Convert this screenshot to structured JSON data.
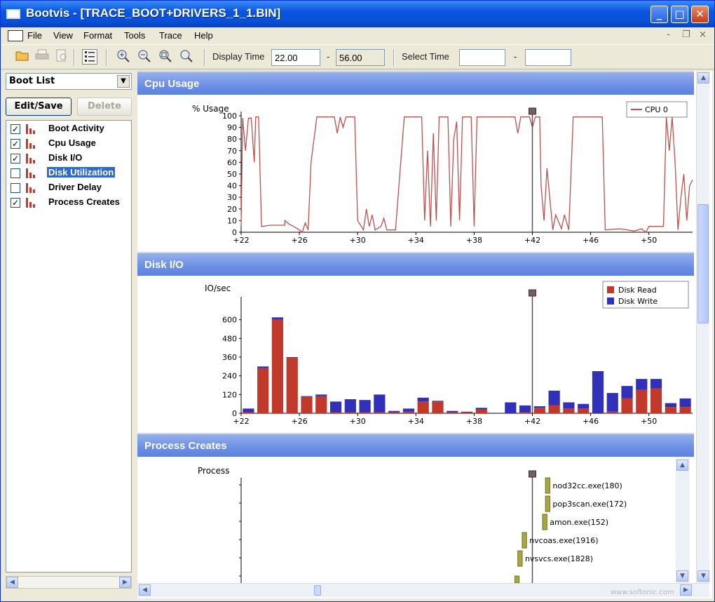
{
  "window": {
    "title": "Bootvis - [TRACE_BOOT+DRIVERS_1_1.BIN]",
    "min_glyph": "_",
    "max_glyph": "□",
    "close_glyph": "✕"
  },
  "menu": {
    "items": [
      "File",
      "View",
      "Format",
      "Tools",
      "Trace",
      "Help"
    ],
    "mdi_controls": [
      "-",
      "❐",
      "×"
    ]
  },
  "toolbar": {
    "display_time_label": "Display Time",
    "display_time_start": "22.00",
    "display_time_sep": "-",
    "display_time_end": "56.00",
    "select_time_label": "Select Time",
    "select_time_start": "",
    "select_time_sep": "-",
    "select_time_end": ""
  },
  "left": {
    "boot_list_label": "Boot List",
    "edit_save_label": "Edit/Save",
    "delete_label": "Delete",
    "charts": [
      {
        "label": "Boot Activity",
        "checked": true,
        "selected": false
      },
      {
        "label": "Cpu Usage",
        "checked": true,
        "selected": false
      },
      {
        "label": "Disk I/O",
        "checked": true,
        "selected": false
      },
      {
        "label": "Disk Utilization",
        "checked": false,
        "selected": true
      },
      {
        "label": "Driver Delay",
        "checked": false,
        "selected": false
      },
      {
        "label": "Process Creates",
        "checked": true,
        "selected": false
      }
    ]
  },
  "watermark": "www.softonic.com",
  "chart_data": [
    {
      "type": "line",
      "title": "Cpu Usage",
      "ylabel": "% Usage",
      "xlim": [
        22,
        53
      ],
      "ylim": [
        0,
        100
      ],
      "y_ticks": [
        0,
        10,
        20,
        30,
        40,
        50,
        60,
        70,
        80,
        90,
        100
      ],
      "x_ticks": [
        22,
        26,
        30,
        34,
        38,
        42,
        46,
        50
      ],
      "x_tick_labels": [
        "+22",
        "+26",
        "+30",
        "+34",
        "+38",
        "+42",
        "+46",
        "+50"
      ],
      "legend": "top-right",
      "marker_x": 42,
      "series": [
        {
          "name": "CPU 0",
          "color": "#c0504d",
          "points": [
            [
              22,
              5
            ],
            [
              22.1,
              98
            ],
            [
              22.3,
              70
            ],
            [
              22.5,
              98
            ],
            [
              22.7,
              98
            ],
            [
              22.9,
              60
            ],
            [
              23,
              99
            ],
            [
              23.2,
              99
            ],
            [
              23.4,
              5
            ],
            [
              24,
              6
            ],
            [
              25,
              6
            ],
            [
              25,
              10
            ],
            [
              25.3,
              7
            ],
            [
              25.6,
              5
            ],
            [
              26,
              2
            ],
            [
              26.2,
              0
            ],
            [
              26.4,
              8
            ],
            [
              26.6,
              2
            ],
            [
              26.8,
              60
            ],
            [
              27.2,
              99
            ],
            [
              28.4,
              99
            ],
            [
              28.6,
              85
            ],
            [
              28.8,
              99
            ],
            [
              29.0,
              90
            ],
            [
              29.2,
              99
            ],
            [
              29.8,
              99
            ],
            [
              30,
              10
            ],
            [
              30.4,
              2
            ],
            [
              30.6,
              20
            ],
            [
              30.8,
              5
            ],
            [
              31,
              15
            ],
            [
              31.2,
              2
            ],
            [
              31.6,
              5
            ],
            [
              31.8,
              12
            ],
            [
              32,
              2
            ],
            [
              32.6,
              2
            ],
            [
              33.2,
              99
            ],
            [
              34.4,
              99
            ],
            [
              34.6,
              10
            ],
            [
              34.8,
              70
            ],
            [
              35,
              5
            ],
            [
              35.2,
              85
            ],
            [
              35.4,
              10
            ],
            [
              35.6,
              99
            ],
            [
              36.2,
              99
            ],
            [
              36.4,
              5
            ],
            [
              36.6,
              80
            ],
            [
              36.8,
              95
            ],
            [
              37,
              10
            ],
            [
              37.2,
              99
            ],
            [
              37.8,
              99
            ],
            [
              38,
              5
            ],
            [
              38.2,
              99
            ],
            [
              40.8,
              99
            ],
            [
              41,
              85
            ],
            [
              41.2,
              99
            ],
            [
              41.8,
              99
            ],
            [
              42,
              90
            ],
            [
              42.2,
              99
            ],
            [
              42.5,
              99
            ],
            [
              42.6,
              40
            ],
            [
              42.8,
              10
            ],
            [
              43,
              55
            ],
            [
              43.4,
              2
            ],
            [
              43.6,
              15
            ],
            [
              44,
              3
            ],
            [
              44.2,
              15
            ],
            [
              44.5,
              2
            ],
            [
              44.8,
              99
            ],
            [
              45,
              99
            ],
            [
              46.8,
              99
            ],
            [
              47,
              2
            ],
            [
              48,
              3
            ],
            [
              49,
              1
            ],
            [
              49.5,
              3
            ],
            [
              49.8,
              0
            ],
            [
              50,
              5
            ],
            [
              51,
              5
            ],
            [
              51.2,
              99
            ],
            [
              51.4,
              70
            ],
            [
              51.6,
              99
            ],
            [
              51.8,
              60
            ],
            [
              52,
              2
            ],
            [
              52.2,
              30
            ],
            [
              52.4,
              50
            ],
            [
              52.6,
              10
            ],
            [
              52.8,
              40
            ],
            [
              53,
              45
            ]
          ]
        }
      ]
    },
    {
      "type": "bar",
      "title": "Disk I/O",
      "ylabel": "IO/sec",
      "stacked": true,
      "xlim": [
        22,
        53
      ],
      "ylim": [
        0,
        720
      ],
      "y_ticks": [
        0,
        120,
        240,
        360,
        480,
        600
      ],
      "x_ticks": [
        22,
        26,
        30,
        34,
        38,
        42,
        46,
        50
      ],
      "x_tick_labels": [
        "+22",
        "+26",
        "+30",
        "+34",
        "+38",
        "+42",
        "+46",
        "+50"
      ],
      "legend": "top-right",
      "marker_x": 42,
      "bar_times": [
        22,
        23,
        24,
        25,
        26,
        27,
        28,
        29,
        30,
        31,
        32,
        33,
        34,
        35,
        36,
        37,
        38,
        39,
        40,
        41,
        42,
        43,
        44,
        45,
        46,
        47,
        48,
        49,
        50,
        51,
        52
      ],
      "series": [
        {
          "name": "Disk Read",
          "color": "#c0392b",
          "values": [
            5,
            290,
            600,
            355,
            105,
            110,
            5,
            5,
            5,
            5,
            5,
            10,
            75,
            75,
            5,
            5,
            25,
            0,
            0,
            5,
            35,
            50,
            30,
            30,
            0,
            10,
            95,
            150,
            160,
            40,
            40
          ]
        },
        {
          "name": "Disk Write",
          "color": "#3030b8",
          "values": [
            25,
            10,
            15,
            5,
            5,
            10,
            70,
            85,
            80,
            115,
            10,
            20,
            25,
            5,
            10,
            5,
            10,
            0,
            70,
            45,
            10,
            95,
            40,
            30,
            270,
            120,
            80,
            70,
            60,
            25,
            55
          ]
        }
      ]
    },
    {
      "type": "gantt",
      "title": "Process Creates",
      "ylabel": "Process",
      "marker_x": 42,
      "bars": [
        {
          "label": "nod32cc.exe(180)",
          "start": 42.9,
          "end": 43.2
        },
        {
          "label": "pop3scan.exe(172)",
          "start": 42.9,
          "end": 43.2
        },
        {
          "label": "amon.exe(152)",
          "start": 42.7,
          "end": 43.0
        },
        {
          "label": "nvcoas.exe(1916)",
          "start": 41.3,
          "end": 41.6
        },
        {
          "label": "nvsvcs.exe(1828)",
          "start": 41.0,
          "end": 41.3
        }
      ]
    }
  ]
}
